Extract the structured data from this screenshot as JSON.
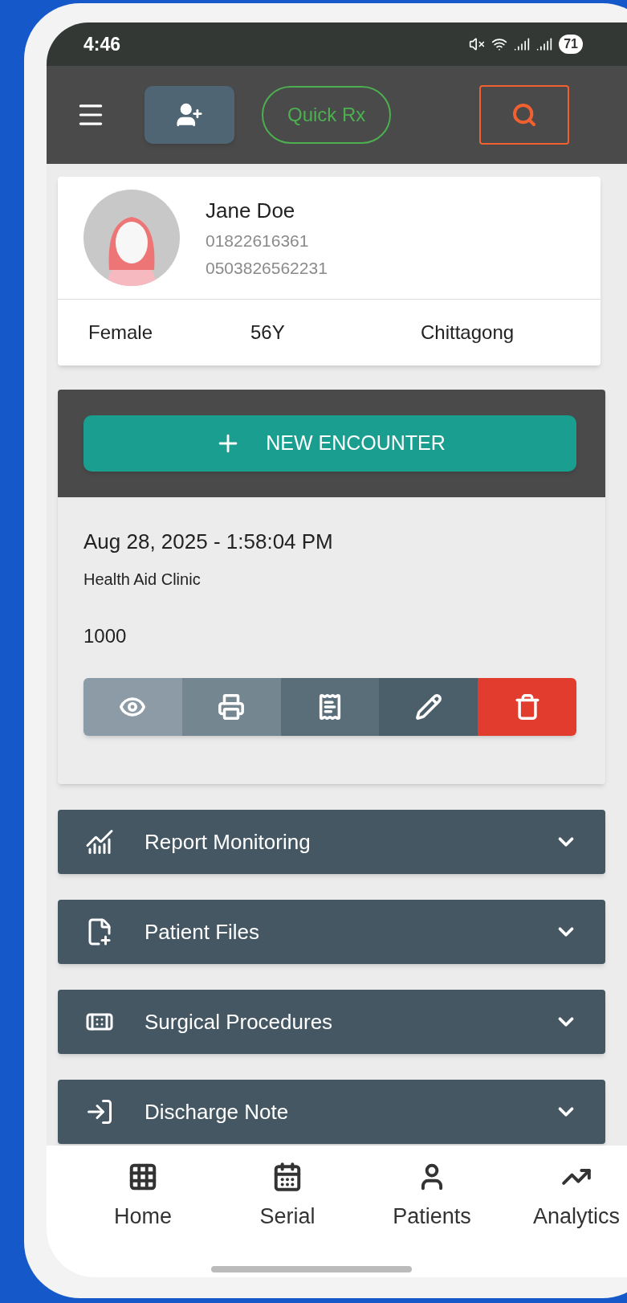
{
  "status_bar": {
    "time": "4:46",
    "battery": "71"
  },
  "toolbar": {
    "quick_button": "Quick Rx"
  },
  "patient": {
    "name": "Jane Doe",
    "phones": [
      "01822616361",
      "0503826562231"
    ],
    "gender": "Female",
    "age": "56Y",
    "city": "Chittagong"
  },
  "new_encounter_button": "NEW ENCOUNTER",
  "encounter": {
    "datetime": "Aug 28, 2025 - 1:58:04 PM",
    "clinic": "Health Aid Clinic",
    "amount": "1000"
  },
  "sections": [
    {
      "kind": "report",
      "title": "Report Monitoring",
      "expanded": false
    },
    {
      "kind": "files",
      "title": "Patient Files",
      "expanded": false
    },
    {
      "kind": "surgery",
      "title": "Surgical Procedures",
      "expanded": false
    },
    {
      "kind": "discharge",
      "title": "Discharge Note",
      "expanded": false
    }
  ],
  "bottom_nav": [
    {
      "kind": "home",
      "label": "Home"
    },
    {
      "kind": "serial",
      "label": "Serial"
    },
    {
      "kind": "patients",
      "label": "Patients"
    },
    {
      "kind": "analytics",
      "label": "Analytics"
    }
  ]
}
